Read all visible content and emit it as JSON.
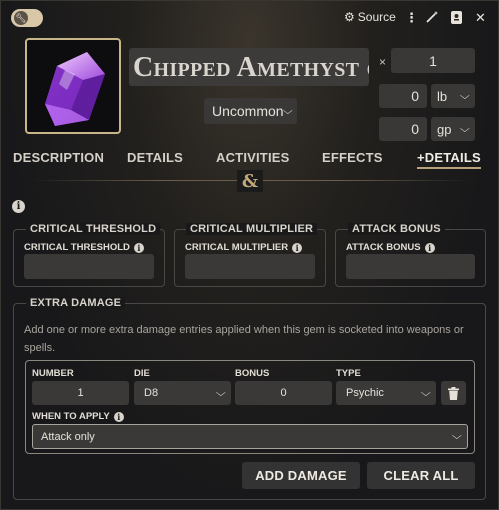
{
  "header": {
    "toggle_icon": "wrench-icon",
    "source_label": "Source",
    "icons": [
      "gear-icon",
      "kebab-menu-icon",
      "magic-wand-icon",
      "sheet-icon",
      "close-icon"
    ]
  },
  "item": {
    "name": "Chipped Amethyst of Sti",
    "multiplier_symbol": "×",
    "quantity": "1",
    "weight_value": "0",
    "weight_unit": "lb",
    "price_value": "0",
    "price_unit": "gp",
    "rarity": "Uncommon",
    "portrait_color": "#9b3fd8"
  },
  "tabs": [
    {
      "label": "DESCRIPTION",
      "active": false
    },
    {
      "label": "DETAILS",
      "active": false
    },
    {
      "label": "ACTIVITIES",
      "active": false
    },
    {
      "label": "EFFECTS",
      "active": false
    },
    {
      "label": "+DETAILS",
      "active": true
    }
  ],
  "divider_glyph": "&",
  "sections": {
    "critical_threshold": {
      "legend": "CRITICAL THRESHOLD",
      "label": "CRITICAL THRESHOLD",
      "value": ""
    },
    "critical_multiplier": {
      "legend": "CRITICAL MULTIPLIER",
      "label": "CRITICAL MULTIPLIER",
      "value": ""
    },
    "attack_bonus": {
      "legend": "ATTACK BONUS",
      "label": "ATTACK BONUS",
      "value": ""
    }
  },
  "extra_damage": {
    "legend": "EXTRA DAMAGE",
    "description": "Add one or more extra damage entries applied when this gem is socketed into weapons or spells.",
    "columns": {
      "number": "NUMBER",
      "die": "DIE",
      "bonus": "BONUS",
      "type": "TYPE"
    },
    "entry": {
      "number": "1",
      "die": "D8",
      "bonus": "0",
      "type": "Psychic"
    },
    "when_label": "WHEN TO APPLY",
    "when_value": "Attack only",
    "add_button": "ADD DAMAGE",
    "clear_button": "CLEAR ALL"
  },
  "colors": {
    "accent_gold": "#b8a37a",
    "amethyst": "#9b3fd8"
  }
}
